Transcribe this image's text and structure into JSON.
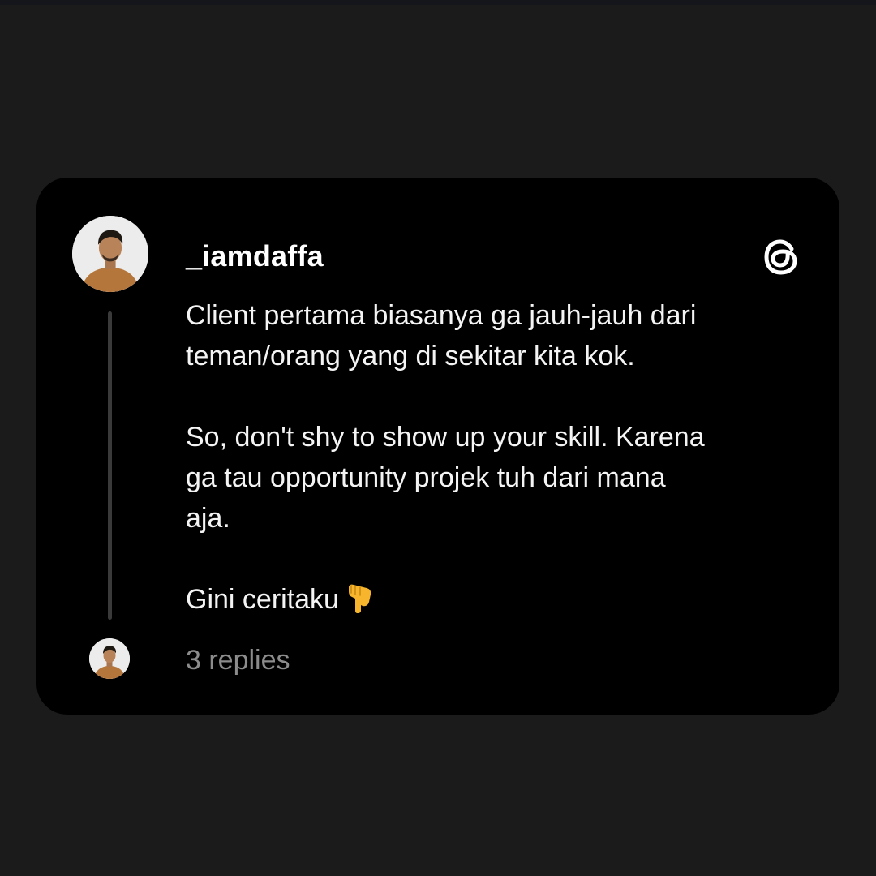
{
  "post": {
    "username": "_iamdaffa",
    "paragraphs": [
      [
        "Client pertama biasanya ga jauh-jauh dari",
        "teman/orang yang di sekitar kita kok."
      ],
      [
        "So, don't shy to show up your skill. Karena",
        "ga tau opportunity projek tuh dari mana",
        "aja."
      ],
      [
        "Gini ceritaku"
      ]
    ],
    "pointing_emoji": "👇",
    "replies_label": "3 replies"
  },
  "icons": {
    "brand": "threads-logo-icon",
    "avatar": "avatar-photo",
    "emoji": "backhand-index-pointing-down"
  },
  "colors": {
    "page_background": "#1b1b1b",
    "card_background": "#000000",
    "text_primary": "#ffffff",
    "text_secondary": "#8c8c8c",
    "thread_line": "#3a3a3a"
  }
}
